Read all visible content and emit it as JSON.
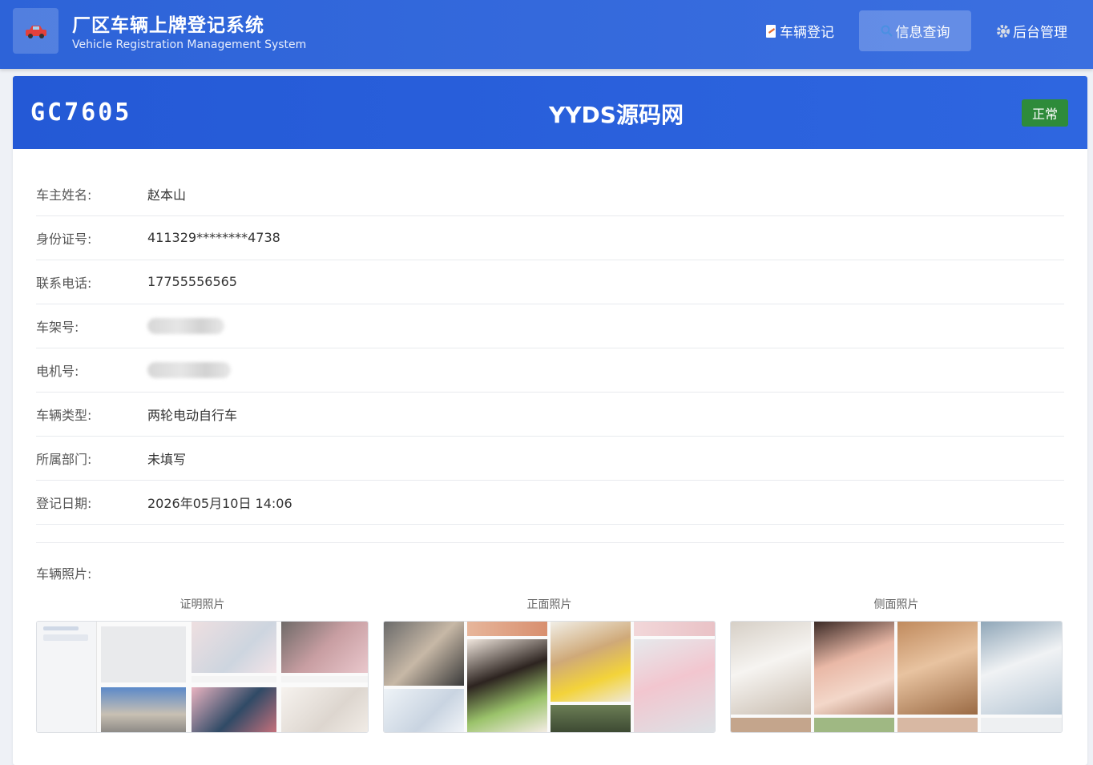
{
  "header": {
    "title": "厂区车辆上牌登记系统",
    "subtitle": "Vehicle Registration Management System",
    "nav": {
      "register": "车辆登记",
      "query": "信息查询",
      "admin": "后台管理"
    }
  },
  "card": {
    "plate": "GC7605",
    "watermark": "YYDS源码网",
    "status": "正常"
  },
  "fields": [
    {
      "label": "车主姓名:",
      "value": "赵本山"
    },
    {
      "label": "身份证号:",
      "value": "411329********4738"
    },
    {
      "label": "联系电话:",
      "value": "17755556565"
    },
    {
      "label": "车架号:",
      "value": ""
    },
    {
      "label": "电机号:",
      "value": ""
    },
    {
      "label": "车辆类型:",
      "value": "两轮电动自行车"
    },
    {
      "label": "所属部门:",
      "value": "未填写"
    },
    {
      "label": "登记日期:",
      "value": "2026年05月10日 14:06"
    }
  ],
  "photos": {
    "label": "车辆照片:",
    "items": [
      {
        "caption": "证明照片"
      },
      {
        "caption": "正面照片"
      },
      {
        "caption": "侧面照片"
      }
    ]
  },
  "colors": {
    "header_bg": "#3066dc",
    "status_green": "#2e8b3a"
  }
}
